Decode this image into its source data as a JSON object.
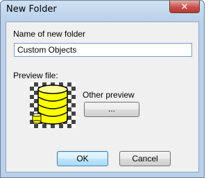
{
  "window": {
    "title": "New Folder",
    "close_glyph": "✕"
  },
  "form": {
    "name_label": "Name of new folder",
    "name_value": "Custom Objects",
    "preview_label": "Preview file:",
    "preview_icon": "database-icon",
    "other_preview_label": "Other preview",
    "browse_label": "...",
    "ok_label": "OK",
    "cancel_label": "Cancel"
  },
  "colors": {
    "database_fill": "#ffff00",
    "accent_border": "#3c7fb1"
  }
}
